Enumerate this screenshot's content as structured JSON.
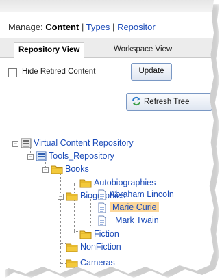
{
  "manage": {
    "prefix": "Manage:",
    "active": "Content",
    "sep1": "|",
    "types": "Types",
    "sep2": "|",
    "repository": "Repositor"
  },
  "tabs": [
    "Repository View",
    "Workspace View"
  ],
  "filter": {
    "hide_retired_label": "Hide Retired Content",
    "hide_retired_checked": false
  },
  "buttons": {
    "update": "Update",
    "refresh_tree": "Refresh Tree"
  },
  "tree": {
    "root": "Virtual Content Repository",
    "repo": "Tools_Repository",
    "books": "Books",
    "autobiographies": "Autobiographies",
    "biographies": "Biographies",
    "abraham": "Abraham Lincoln",
    "marie": "Marie Curie",
    "twain": "Mark Twain",
    "fiction": "Fiction",
    "nonfiction": "NonFiction",
    "cameras": "Cameras",
    "selected": "Marie Curie"
  },
  "icons": {
    "folder": "folder-icon",
    "repository": "repository-icon",
    "document": "document-icon",
    "refresh": "refresh-icon"
  },
  "colors": {
    "link": "#1a4ab8",
    "selection": "#fcd79b",
    "folder": "#f3c93b"
  }
}
